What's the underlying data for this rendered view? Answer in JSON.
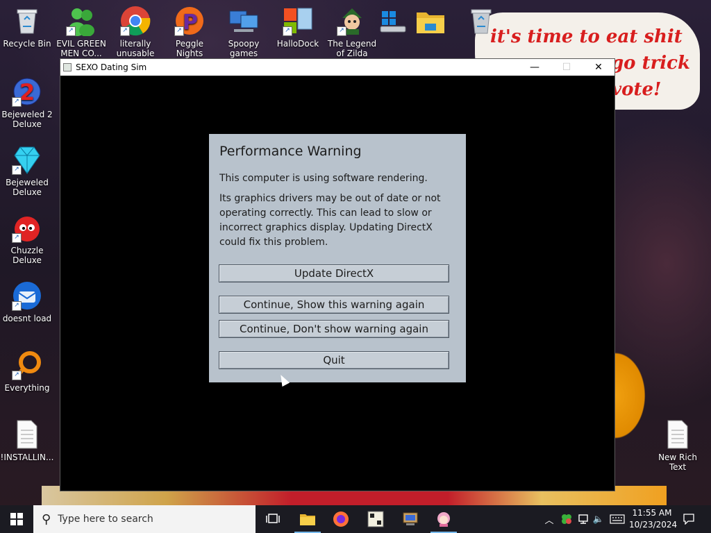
{
  "desktop": {
    "icons": [
      {
        "label": "Recycle Bin",
        "icon": "recycle-bin-icon"
      },
      {
        "label": "EVIL GREEN MEN CO...",
        "icon": "green-men-icon"
      },
      {
        "label": "literally unusable",
        "icon": "chrome-icon"
      },
      {
        "label": "Peggle Nights Deluxe",
        "icon": "peggle-icon"
      },
      {
        "label": "Spoopy games",
        "icon": "computers-icon"
      },
      {
        "label": "HalloDock",
        "icon": "hallodock-icon"
      },
      {
        "label": "The Legend of Zilda",
        "icon": "zilda-icon"
      },
      {
        "label": "Bejeweled 2 Deluxe",
        "icon": "bejeweled2-icon"
      },
      {
        "label": "Bejeweled Deluxe",
        "icon": "bejeweled-icon"
      },
      {
        "label": "Chuzzle Deluxe",
        "icon": "chuzzle-icon"
      },
      {
        "label": "doesnt load",
        "icon": "thunderbird-icon"
      },
      {
        "label": "Everything",
        "icon": "everything-icon"
      },
      {
        "label": "!INSTALLIN...",
        "icon": "text-file-icon"
      },
      {
        "label": "New Rich Text Document.txt",
        "icon": "text-file-icon"
      }
    ],
    "wallpaper_text": [
      "it's time to eat shit",
      "go trick",
      "vote!"
    ]
  },
  "window": {
    "title": "SEXO Dating Sim",
    "controls": {
      "minimize": "—",
      "maximize": "☐",
      "close": "✕"
    }
  },
  "dialog": {
    "heading": "Performance Warning",
    "line1": "This computer is using software rendering.",
    "line2": "Its graphics drivers may be out of date or not operating correctly. This can lead to slow or incorrect graphics display. Updating DirectX could fix this problem.",
    "buttons": {
      "update": "Update DirectX",
      "continue_show": "Continue, Show this warning again",
      "continue_dont": "Continue, Don't show warning again",
      "quit": "Quit"
    }
  },
  "taskbar": {
    "search_placeholder": "Type here to search",
    "time": "11:55 AM",
    "date": "10/23/2024",
    "accent": "#76b9ed"
  }
}
